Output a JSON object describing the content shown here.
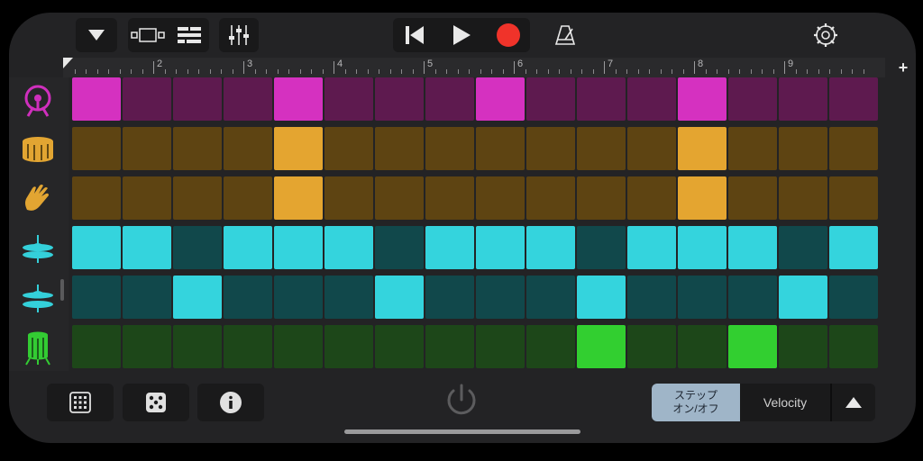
{
  "colors": {
    "magenta_on": "#d531c0",
    "magenta_off": "#5e1a4f",
    "amber_on": "#e4a530",
    "amber_off": "#5e4412",
    "cyan_on": "#34d4dd",
    "cyan_off": "#11484b",
    "green_on": "#32cf30",
    "green_off": "#1d4719"
  },
  "toolbar": {
    "icons": [
      "dropdown-icon",
      "tracks-view-icon",
      "arrange-view-icon",
      "mixer-icon",
      "rewind-icon",
      "play-icon",
      "record-icon",
      "metronome-icon",
      "settings-icon"
    ]
  },
  "ruler": {
    "bar_numbers": [
      "2",
      "3",
      "4",
      "5",
      "6",
      "7",
      "8",
      "9"
    ],
    "add_label": "+"
  },
  "rows": [
    {
      "instrument": "kick-drum-icon",
      "color": "magenta",
      "steps": [
        1,
        0,
        0,
        0,
        1,
        0,
        0,
        0,
        1,
        0,
        0,
        0,
        1,
        0,
        0,
        0
      ]
    },
    {
      "instrument": "snare-drum-icon",
      "color": "amber",
      "steps": [
        0,
        0,
        0,
        0,
        1,
        0,
        0,
        0,
        0,
        0,
        0,
        0,
        1,
        0,
        0,
        0
      ]
    },
    {
      "instrument": "hand-clap-icon",
      "color": "amber",
      "steps": [
        0,
        0,
        0,
        0,
        1,
        0,
        0,
        0,
        0,
        0,
        0,
        0,
        1,
        0,
        0,
        0
      ]
    },
    {
      "instrument": "hi-hat-closed-icon",
      "color": "cyan",
      "steps": [
        1,
        1,
        0,
        1,
        1,
        1,
        0,
        1,
        1,
        1,
        0,
        1,
        1,
        1,
        0,
        1
      ]
    },
    {
      "instrument": "hi-hat-open-icon",
      "color": "cyan",
      "steps": [
        0,
        0,
        1,
        0,
        0,
        0,
        1,
        0,
        0,
        0,
        1,
        0,
        0,
        0,
        1,
        0
      ]
    },
    {
      "instrument": "floor-tom-icon",
      "color": "green",
      "steps": [
        0,
        0,
        0,
        0,
        0,
        0,
        0,
        0,
        0,
        0,
        1,
        0,
        0,
        1,
        0,
        0
      ]
    }
  ],
  "bottom": {
    "step_mode_line1": "ステップ",
    "step_mode_line2": "オン/オフ",
    "velocity_label": "Velocity"
  }
}
